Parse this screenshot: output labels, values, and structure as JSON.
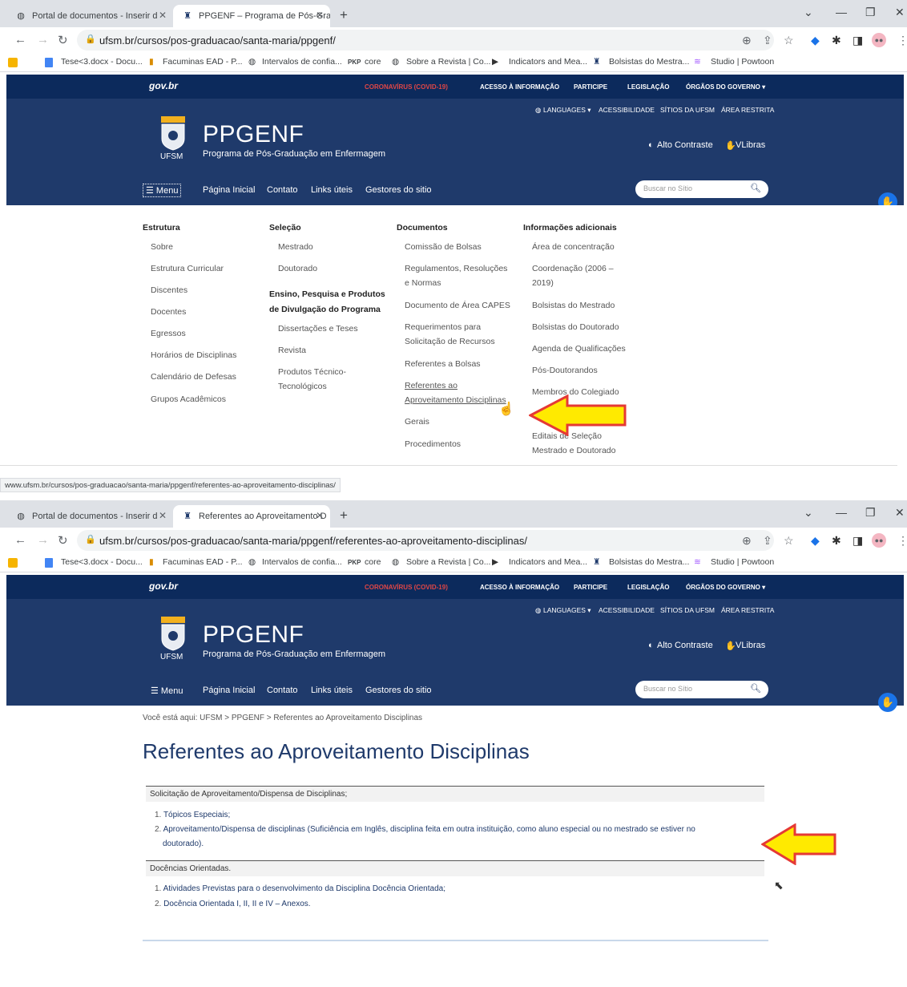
{
  "shot1": {
    "tabs": [
      {
        "label": "Portal de documentos - Inserir d",
        "icon": "globe-icon"
      },
      {
        "label": "PPGENF – Programa de Pós-Grad",
        "icon": "ufsm-icon"
      }
    ],
    "url": "ufsm.br/cursos/pos-graduacao/santa-maria/ppgenf/",
    "status_url": "www.ufsm.br/cursos/pos-graduacao/santa-maria/ppgenf/referentes-ao-aproveitamento-disciplinas/"
  },
  "shot2": {
    "tabs": [
      {
        "label": "Portal de documentos - Inserir d",
        "icon": "globe-icon"
      },
      {
        "label": "Referentes ao Aproveitamento D",
        "icon": "ufsm-icon"
      }
    ],
    "url": "ufsm.br/cursos/pos-graduacao/santa-maria/ppgenf/referentes-ao-aproveitamento-disciplinas/"
  },
  "bookmarks": [
    "Tese<3.docx - Docu...",
    "Facuminas EAD - P...",
    "Intervalos de confia...",
    "core",
    "Sobre a Revista | Co...",
    "Indicators and Mea...",
    "Bolsistas do Mestra...",
    "Studio | Powtoon"
  ],
  "bookmark_pkp": "PKP",
  "gov": {
    "logo": "gov.br",
    "links": [
      "CORONAVÍRUS (COVID-19)",
      "ACESSO À INFORMAÇÃO",
      "PARTICIPE",
      "LEGISLAÇÃO",
      "ÓRGÃOS DO GOVERNO ▾"
    ]
  },
  "header": {
    "toplinks": [
      "LANGUAGES ▾",
      "ACESSIBILIDADE",
      "SÍTIOS DA UFSM",
      "ÁREA RESTRITA"
    ],
    "brand": "PPGENF",
    "subtitle": "Programa de Pós-Graduação em Enfermagem",
    "logo_text": "UFSM",
    "contrast": "Alto Contraste",
    "vlibras": "VLibras",
    "nav": [
      "Menu",
      "Página Inicial",
      "Contato",
      "Links úteis",
      "Gestores do sitio"
    ],
    "search_placeholder": "Buscar no Sítio"
  },
  "mega": {
    "estrutura_title": "Estrutura",
    "estrutura": [
      "Sobre",
      "Estrutura Curricular",
      "Discentes",
      "Docentes",
      "Egressos",
      "Horários de Disciplinas",
      "Calendário de Defesas",
      "Grupos Acadêmicos"
    ],
    "selecao_title": "Seleção",
    "selecao": [
      "Mestrado",
      "Doutorado"
    ],
    "ensino_title_1": "Ensino, Pesquisa e Produtos",
    "ensino_title_2": "de Divulgação do Programa",
    "ensino": [
      "Dissertações e Teses",
      "Revista",
      "Produtos Técnico-",
      "Tecnológicos"
    ],
    "documentos_title": "Documentos",
    "documentos": [
      "Comissão de Bolsas",
      "Regulamentos, Resoluções",
      "e Normas",
      "Documento de Área CAPES",
      "Requerimentos para",
      "Solicitação de Recursos",
      "Referentes a Bolsas",
      "Referentes ao",
      "Aproveitamento Disciplinas",
      "Gerais",
      "Procedimentos"
    ],
    "info_title": "Informações adicionais",
    "info": [
      "Área de concentração",
      "Coordenação (2006 –",
      "2019)",
      "Bolsistas do Mestrado",
      "Bolsistas do Doutorado",
      "Agenda de Qualificações",
      "Pós-Doutorandos",
      "Membros do Colegiado",
      "Editais de Seleção",
      "Mestrado e Doutorado"
    ]
  },
  "page": {
    "breadcrumb": "Você está aqui: UFSM > PPGENF > Referentes ao Aproveitamento Disciplinas",
    "title": "Referentes ao Aproveitamento Disciplinas",
    "section1": "Solicitação de Aproveitamento/Dispensa de Disciplinas;",
    "s1_items": [
      "Tópicos Especiais;",
      "Aproveitamento/Dispensa de disciplinas (Suficiência em Inglês, disciplina feita em outra instituição, como aluno especial ou no mestrado se estiver no",
      "doutorado)."
    ],
    "section2": "Docências Orientadas.",
    "s2_items": [
      "Atividades Previstas para o desenvolvimento da Disciplina Docência Orientada;",
      "Docência Orientada I, II, II e IV – Anexos."
    ],
    "nums": [
      "1.",
      "2."
    ]
  },
  "colors": {
    "site_blue": "#1f3a6b",
    "gov_blue": "#0c2a5c",
    "arrow_yellow": "#ffea00",
    "arrow_red": "#e53935"
  }
}
